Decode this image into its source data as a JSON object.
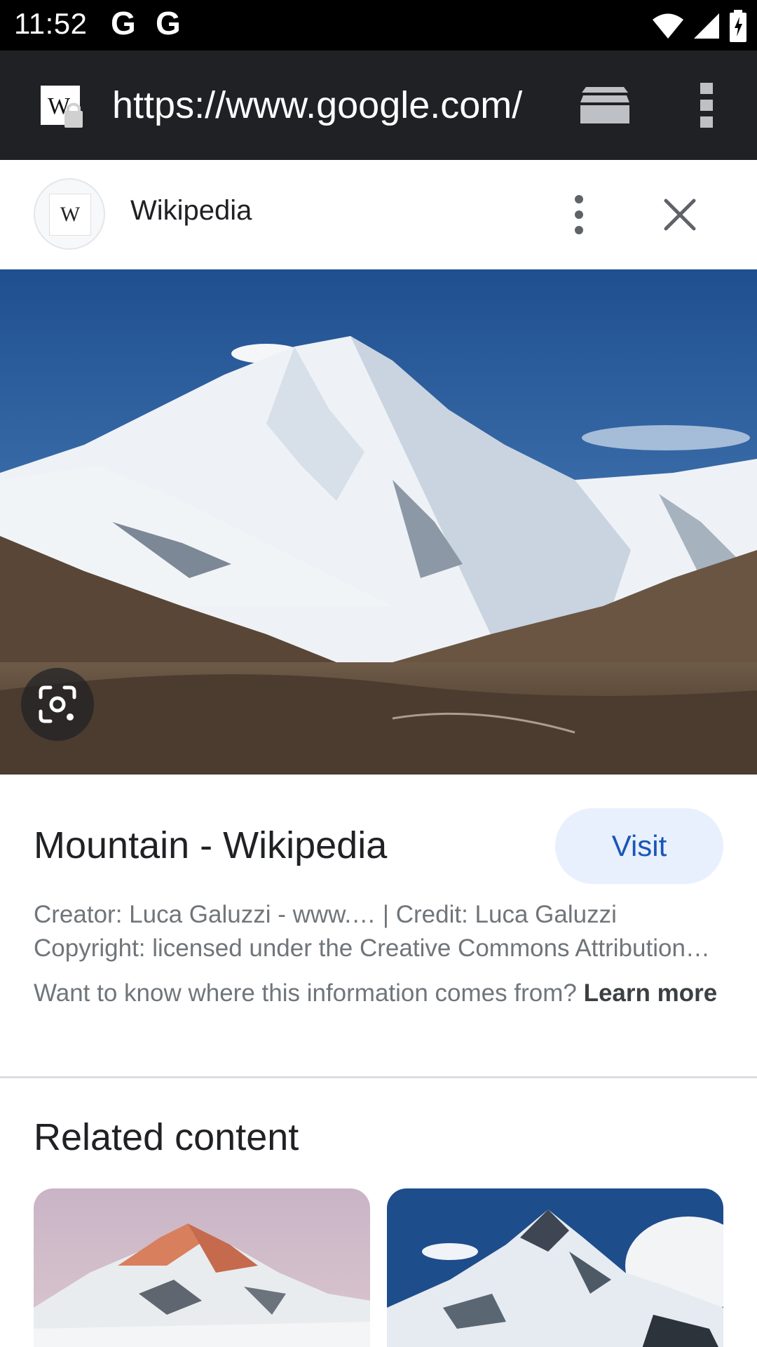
{
  "status_bar": {
    "time": "11:52",
    "notification_icons": [
      "G",
      "G"
    ],
    "system_icons": [
      "wifi-icon",
      "signal-icon",
      "battery-charging-icon"
    ]
  },
  "browser": {
    "url": "https://www.google.com/",
    "site_icon": "wikipedia-lock-icon",
    "tabs_icon": "tabs-icon",
    "menu_icon": "more-vert-icon"
  },
  "source": {
    "name": "Wikipedia",
    "avatar_letter": "W"
  },
  "result": {
    "title": "Mountain - Wikipedia",
    "visit_label": "Visit",
    "creator_line": "Creator: Luca Galuzzi - www.… | Credit: Luca Galuzzi",
    "copyright_line": "Copyright: licensed under the Creative Commons Attribution…",
    "source_note": "Want to know where this information comes from?",
    "learn_more": "Learn more"
  },
  "related": {
    "title": "Related content"
  },
  "colors": {
    "toolbar": "#202124",
    "visit_bg": "#e8f0fe",
    "visit_text": "#1a56b8",
    "meta_text": "#70757a"
  }
}
